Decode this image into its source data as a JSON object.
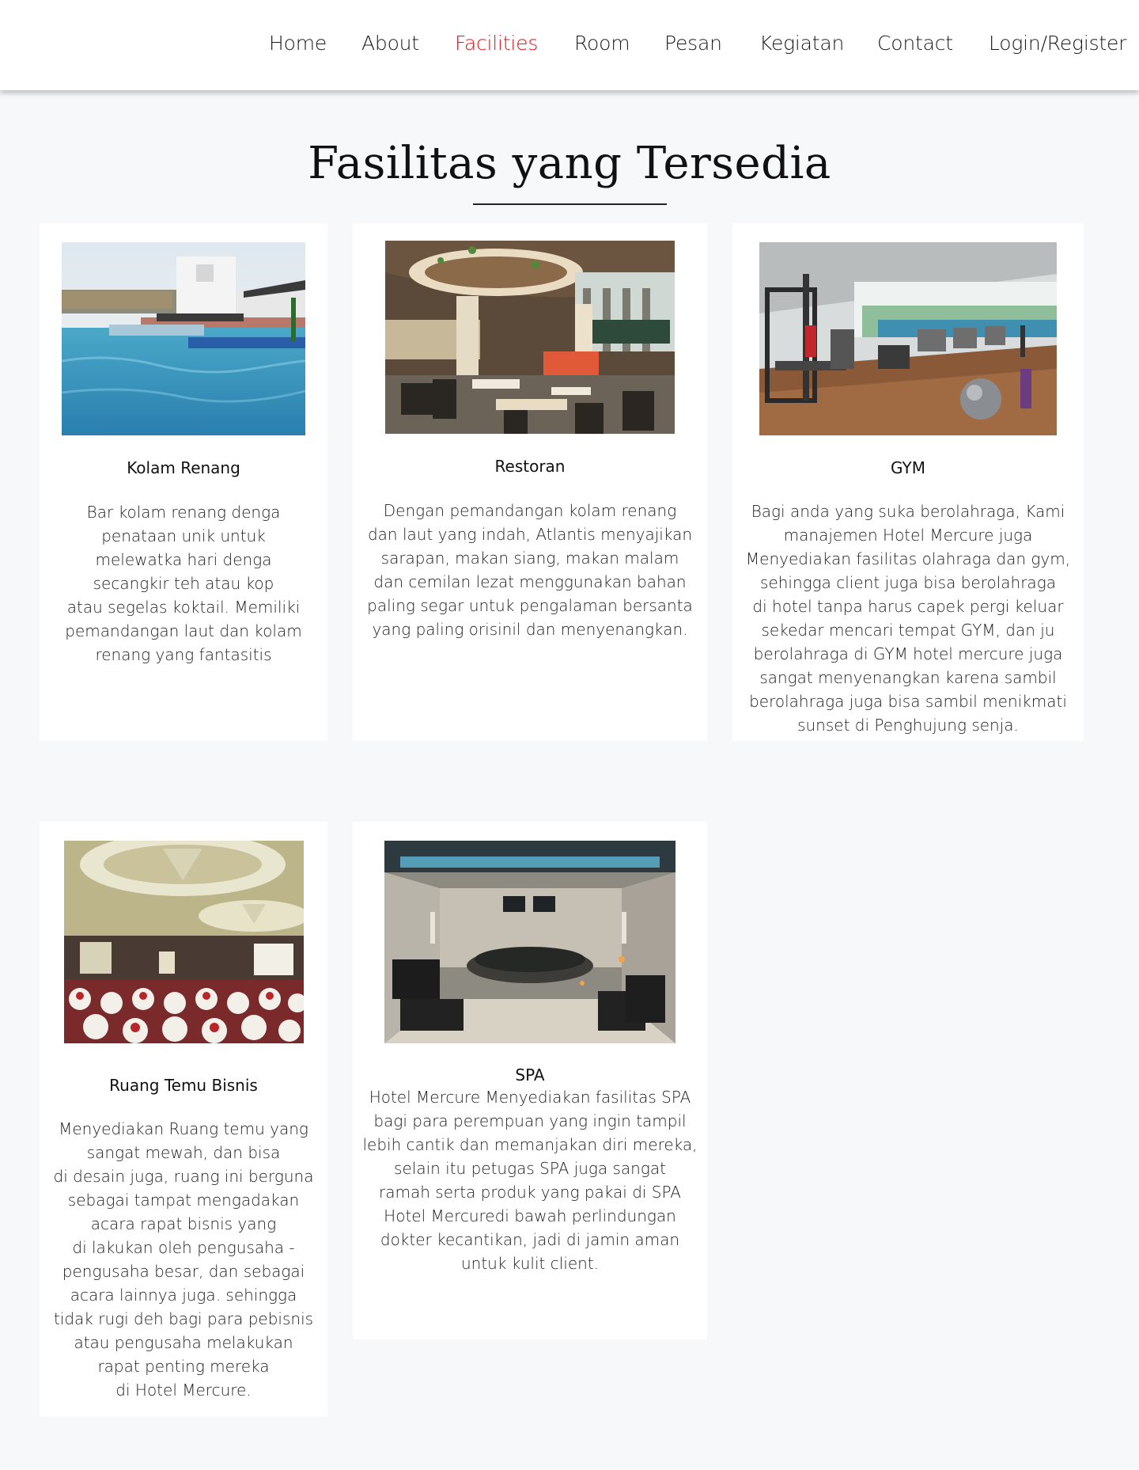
{
  "nav": {
    "home": "Home",
    "about": "About",
    "facilities": "Facilities",
    "room": "Room",
    "pesan": "Pesan",
    "kegiatan": "Kegiatan",
    "contact": "Contact",
    "login": "Login/Register",
    "active_color": "#e8141b"
  },
  "page": {
    "title": "Fasilitas yang Tersedia"
  },
  "facilities": [
    {
      "title": "Kolam Renang",
      "photo": "rooftop-pool-photo",
      "text": "Bar kolam renang denga\npenataan unik untuk\nmelewatka hari denga\nsecangkir teh atau kop\natau segelas koktail. Memiliki\npemandangan laut dan kolam\nrenang yang fantasitis"
    },
    {
      "title": "Restoran",
      "photo": "restaurant-interior-photo",
      "text": "Dengan pemandangan kolam renang\ndan laut yang indah, Atlantis menyajikan\nsarapan, makan siang, makan malam\ndan cemilan lezat menggunakan bahan\npaling segar untuk pengalaman bersanta\nyang paling orisinil dan menyenangkan."
    },
    {
      "title": "GYM",
      "photo": "gym-equipment-photo",
      "text": "Bagi anda yang suka berolahraga, Kami\nmanajemen Hotel Mercure juga\nMenyediakan fasilitas olahraga dan gym,\nsehingga client juga bisa berolahraga\ndi hotel tanpa harus capek pergi keluar\nsekedar mencari tempat GYM, dan ju\nberolahraga di GYM hotel mercure juga\nsangat menyenangkan karena sambil\nberolahraga juga bisa sambil menikmati\nsunset di Penghujung senja."
    },
    {
      "title": "Ruang Temu Bisnis",
      "photo": "ballroom-photo",
      "text": "Menyediakan Ruang temu yang\nsangat mewah, dan bisa\ndi desain juga, ruang ini berguna\nsebagai tampat mengadakan\nacara rapat bisnis yang\ndi lakukan oleh  pengusaha -\npengusaha besar, dan sebagai\nacara lainnya juga. sehingga\ntidak rugi deh bagi para pebisnis\natau pengusaha melakukan\nrapat penting mereka\ndi Hotel Mercure."
    },
    {
      "title": "SPA",
      "photo": "spa-pool-photo",
      "text": "Hotel Mercure Menyediakan fasilitas SPA\nbagi para perempuan yang ingin tampil\nlebih cantik dan memanjakan diri mereka,\nselain itu petugas SPA juga sangat\nramah serta produk yang pakai di SPA\nHotel Mercuredi bawah perlindungan\ndokter kecantikan, jadi di jamin aman\nuntuk kulit client."
    }
  ]
}
